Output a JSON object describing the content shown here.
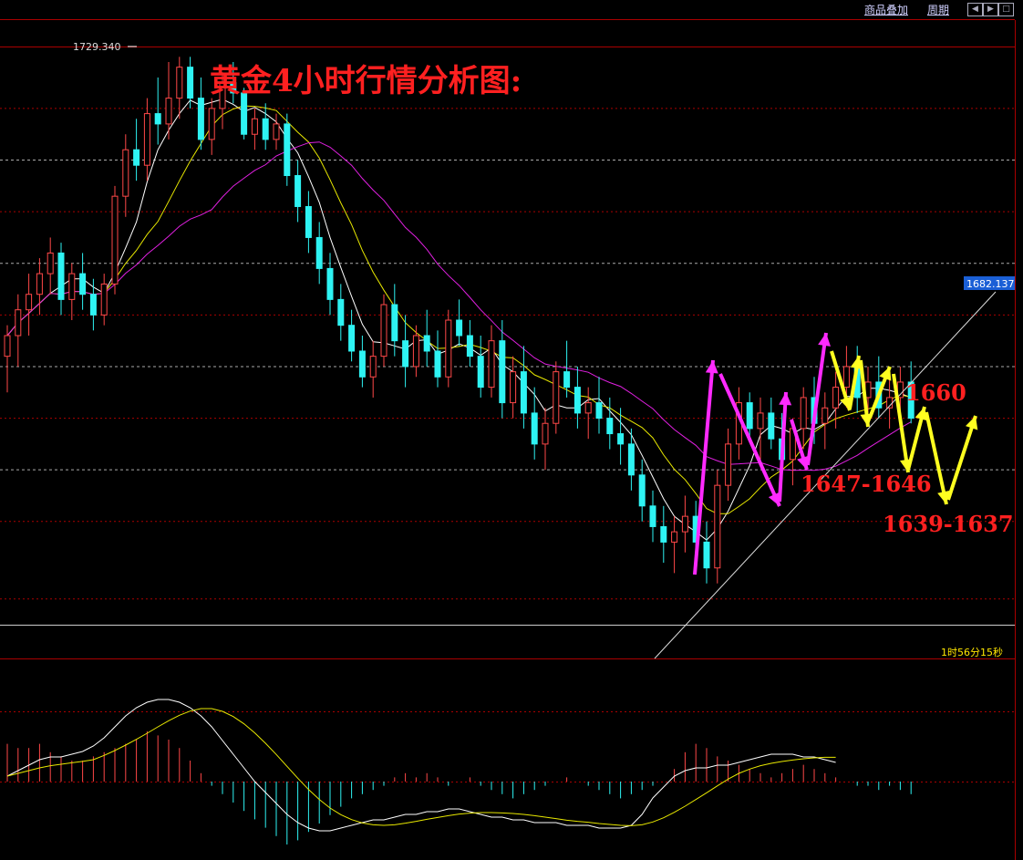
{
  "toolbar": {
    "overlay_label": "商品叠加",
    "period_label": "周期"
  },
  "chart_data": {
    "type": "candlestick",
    "title": "黄金4小时行情分析图:",
    "price_range": [
      1620,
      1732
    ],
    "high_label": "1729.340",
    "current_price_label": "1682.137",
    "countdown_label": "1时56分15秒",
    "annotations": [
      "1660",
      "1647-1646",
      "1639-1637"
    ],
    "candles": [
      [
        1672,
        1678,
        1665,
        1676
      ],
      [
        1676,
        1684,
        1670,
        1681
      ],
      [
        1681,
        1688,
        1676,
        1684
      ],
      [
        1684,
        1691,
        1680,
        1688
      ],
      [
        1688,
        1695,
        1684,
        1692
      ],
      [
        1692,
        1694,
        1680,
        1683
      ],
      [
        1683,
        1690,
        1679,
        1688
      ],
      [
        1688,
        1692,
        1681,
        1684
      ],
      [
        1684,
        1687,
        1677,
        1680
      ],
      [
        1680,
        1688,
        1678,
        1686
      ],
      [
        1686,
        1705,
        1684,
        1703
      ],
      [
        1703,
        1715,
        1699,
        1712
      ],
      [
        1712,
        1718,
        1706,
        1709
      ],
      [
        1709,
        1722,
        1706,
        1719
      ],
      [
        1719,
        1726,
        1713,
        1717
      ],
      [
        1717,
        1729,
        1714,
        1722
      ],
      [
        1722,
        1730,
        1718,
        1728
      ],
      [
        1728,
        1730,
        1720,
        1722
      ],
      [
        1722,
        1726,
        1712,
        1714
      ],
      [
        1714,
        1722,
        1711,
        1720
      ],
      [
        1720,
        1727,
        1716,
        1725
      ],
      [
        1725,
        1729,
        1721,
        1723
      ],
      [
        1723,
        1724,
        1714,
        1715
      ],
      [
        1715,
        1720,
        1712,
        1718
      ],
      [
        1718,
        1721,
        1712,
        1714
      ],
      [
        1714,
        1719,
        1712,
        1717
      ],
      [
        1717,
        1719,
        1705,
        1707
      ],
      [
        1707,
        1710,
        1698,
        1701
      ],
      [
        1701,
        1704,
        1692,
        1695
      ],
      [
        1695,
        1698,
        1686,
        1689
      ],
      [
        1689,
        1692,
        1680,
        1683
      ],
      [
        1683,
        1686,
        1675,
        1678
      ],
      [
        1678,
        1681,
        1671,
        1673
      ],
      [
        1673,
        1676,
        1666,
        1668
      ],
      [
        1668,
        1675,
        1664,
        1672
      ],
      [
        1672,
        1684,
        1670,
        1682
      ],
      [
        1682,
        1686,
        1672,
        1675
      ],
      [
        1675,
        1680,
        1666,
        1670
      ],
      [
        1670,
        1678,
        1668,
        1676
      ],
      [
        1676,
        1681,
        1670,
        1673
      ],
      [
        1673,
        1677,
        1666,
        1668
      ],
      [
        1668,
        1681,
        1666,
        1679
      ],
      [
        1679,
        1683,
        1674,
        1676
      ],
      [
        1676,
        1679,
        1670,
        1672
      ],
      [
        1672,
        1676,
        1664,
        1666
      ],
      [
        1666,
        1678,
        1664,
        1675
      ],
      [
        1675,
        1679,
        1660,
        1663
      ],
      [
        1663,
        1672,
        1660,
        1669
      ],
      [
        1669,
        1674,
        1658,
        1661
      ],
      [
        1661,
        1666,
        1652,
        1655
      ],
      [
        1655,
        1662,
        1650,
        1659
      ],
      [
        1659,
        1671,
        1657,
        1669
      ],
      [
        1669,
        1675,
        1664,
        1666
      ],
      [
        1666,
        1670,
        1658,
        1661
      ],
      [
        1661,
        1666,
        1656,
        1663
      ],
      [
        1663,
        1668,
        1657,
        1660
      ],
      [
        1660,
        1664,
        1654,
        1657
      ],
      [
        1657,
        1662,
        1651,
        1655
      ],
      [
        1655,
        1658,
        1646,
        1649
      ],
      [
        1649,
        1652,
        1640,
        1643
      ],
      [
        1643,
        1646,
        1636,
        1639
      ],
      [
        1639,
        1643,
        1632,
        1636
      ],
      [
        1636,
        1641,
        1630,
        1638
      ],
      [
        1638,
        1645,
        1634,
        1641
      ],
      [
        1641,
        1644,
        1633,
        1636
      ],
      [
        1636,
        1640,
        1628,
        1631
      ],
      [
        1631,
        1650,
        1628,
        1647
      ],
      [
        1647,
        1658,
        1644,
        1655
      ],
      [
        1655,
        1666,
        1652,
        1663
      ],
      [
        1663,
        1665,
        1656,
        1658
      ],
      [
        1658,
        1664,
        1652,
        1661
      ],
      [
        1661,
        1664,
        1654,
        1656
      ],
      [
        1656,
        1661,
        1650,
        1652
      ],
      [
        1652,
        1660,
        1647,
        1658
      ],
      [
        1658,
        1666,
        1654,
        1664
      ],
      [
        1664,
        1668,
        1655,
        1659
      ],
      [
        1659,
        1665,
        1654,
        1662
      ],
      [
        1662,
        1669,
        1658,
        1666
      ],
      [
        1666,
        1674,
        1662,
        1670
      ],
      [
        1670,
        1674,
        1661,
        1664
      ],
      [
        1664,
        1670,
        1660,
        1667
      ],
      [
        1667,
        1672,
        1660,
        1662
      ],
      [
        1662,
        1668,
        1658,
        1664
      ],
      [
        1664,
        1670,
        1661,
        1667
      ],
      [
        1667,
        1671,
        1659,
        1660
      ]
    ],
    "macd": {
      "hist": [
        9,
        8,
        8,
        9,
        7,
        6,
        5,
        5,
        6,
        7,
        8,
        9,
        10,
        12,
        11,
        10,
        8,
        5,
        2,
        -1,
        -3,
        -5,
        -7,
        -9,
        -11,
        -13,
        -15,
        -14,
        -12,
        -10,
        -8,
        -6,
        -4,
        -3,
        -2,
        -1,
        1,
        2,
        1,
        2,
        1,
        -1,
        0,
        1,
        -1,
        -2,
        -3,
        -4,
        -3,
        -2,
        -1,
        0,
        1,
        0,
        -1,
        -2,
        -3,
        -4,
        -3,
        -2,
        -1,
        0,
        3,
        7,
        9,
        8,
        6,
        5,
        4,
        3,
        2,
        1,
        2,
        3,
        4,
        3,
        2,
        1,
        0,
        -1,
        -1,
        -2,
        -1,
        -2,
        -3
      ],
      "dif": [
        2,
        4,
        6,
        8,
        9,
        9,
        10,
        11,
        13,
        16,
        20,
        24,
        27,
        29,
        30,
        30,
        29,
        27,
        24,
        20,
        15,
        10,
        5,
        0,
        -4,
        -8,
        -12,
        -15,
        -17,
        -18,
        -18,
        -17,
        -16,
        -15,
        -14,
        -14,
        -13,
        -12,
        -12,
        -11,
        -11,
        -10,
        -10,
        -11,
        -12,
        -13,
        -13,
        -14,
        -14,
        -15,
        -15,
        -15,
        -16,
        -16,
        -16,
        -17,
        -17,
        -17,
        -16,
        -12,
        -6,
        -2,
        2,
        4,
        5,
        5,
        6,
        6,
        7,
        8,
        9,
        10,
        10,
        10,
        9,
        9,
        8,
        7
      ]
    },
    "ylabel": "",
    "xlabel": ""
  }
}
